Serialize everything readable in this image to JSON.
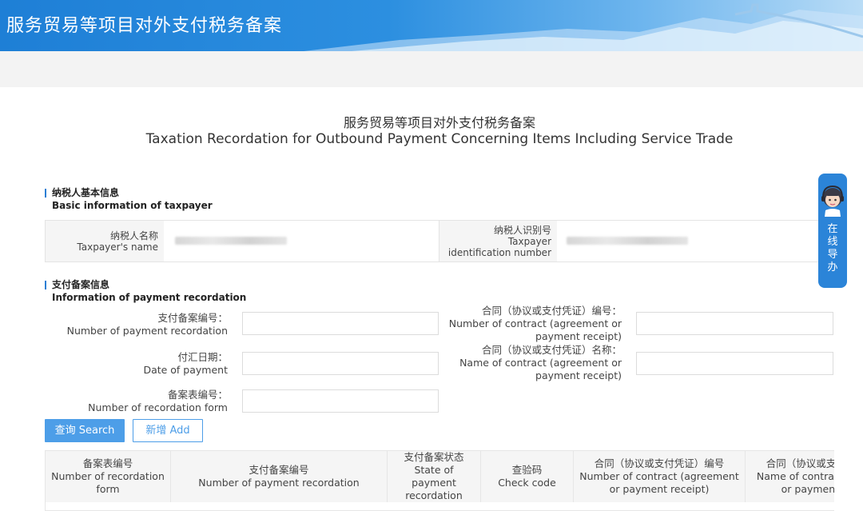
{
  "banner": {
    "title": "服务贸易等项目对外支付税务备案"
  },
  "page": {
    "title_cn": "服务贸易等项目对外支付税务备案",
    "title_en": "Taxation Recordation for Outbound Payment Concerning Items Including Service Trade"
  },
  "taxpayer_section": {
    "title_cn": "纳税人基本信息",
    "title_en": "Basic information of taxpayer",
    "name_label_cn": "纳税人名称",
    "name_label_en": "Taxpayer's name",
    "id_label_cn": "纳税人识别号",
    "id_label_en1": "Taxpayer",
    "id_label_en2": "identification number"
  },
  "payment_section": {
    "title_cn": "支付备案信息",
    "title_en": "Information of payment recordation"
  },
  "form": {
    "payment_no_cn": "支付备案编号：",
    "payment_no_en": "Number of payment recordation",
    "payment_date_cn": "付汇日期：",
    "payment_date_en": "Date of payment",
    "form_no_cn": "备案表编号：",
    "form_no_en": "Number of recordation form",
    "contract_no_cn": "合同（协议或支付凭证）编号：",
    "contract_no_en1": "Number of contract (agreement or",
    "contract_no_en2": "payment receipt)",
    "contract_name_cn": "合同（协议或支付凭证）名称：",
    "contract_name_en1": "Name of contract (agreement or",
    "contract_name_en2": "payment receipt)",
    "payment_no_value": "",
    "payment_date_value": "",
    "form_no_value": "",
    "contract_no_value": "",
    "contract_name_value": ""
  },
  "buttons": {
    "search": "查询 Search",
    "add": "新增 Add"
  },
  "table": {
    "columns": [
      {
        "cn": "备案表编号",
        "en1": "Number of recordation",
        "en2": "form"
      },
      {
        "cn": "支付备案编号",
        "en1": "Number of payment recordation",
        "en2": ""
      },
      {
        "cn": "支付备案状态",
        "en1": "State of payment",
        "en2": "recordation"
      },
      {
        "cn": "查验码",
        "en1": "Check code",
        "en2": ""
      },
      {
        "cn": "合同（协议或支付凭证）编号",
        "en1": "Number of contract (agreement",
        "en2": "or payment receipt)"
      },
      {
        "cn": "合同（协议或支付凭证）名称",
        "en1": "Name of contract (agreement",
        "en2": "or payment receipt)"
      }
    ]
  },
  "helper": {
    "chars": [
      "在",
      "线",
      "导",
      "办"
    ]
  },
  "colors": {
    "primary": "#4d9ee8",
    "banner": "#1e7fd6",
    "helper": "#2b84d8"
  }
}
